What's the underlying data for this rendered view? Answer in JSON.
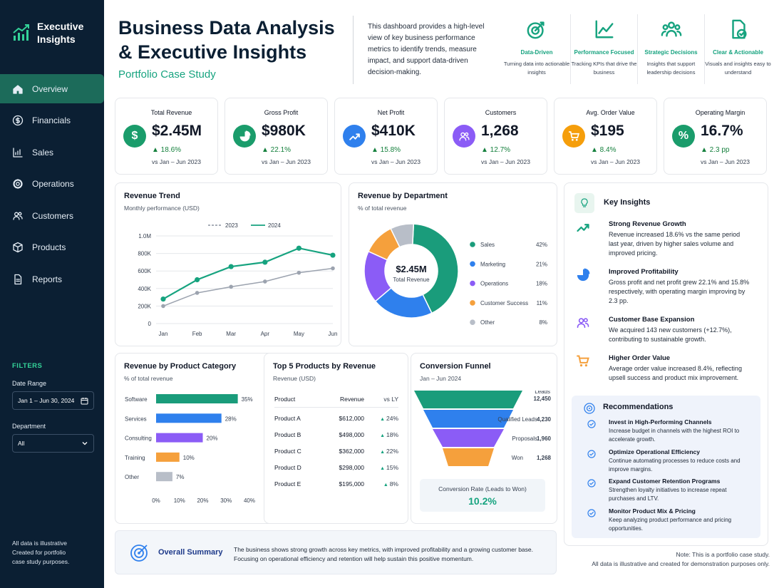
{
  "app": {
    "brand": "Executive Insights"
  },
  "nav": [
    {
      "label": "Overview",
      "icon": "home-icon"
    },
    {
      "label": "Financials",
      "icon": "dollar-icon"
    },
    {
      "label": "Sales",
      "icon": "bar-chart-icon"
    },
    {
      "label": "Operations",
      "icon": "gear-icon"
    },
    {
      "label": "Customers",
      "icon": "users-icon"
    },
    {
      "label": "Products",
      "icon": "box-icon"
    },
    {
      "label": "Reports",
      "icon": "document-icon"
    }
  ],
  "filters": {
    "heading": "FILTERS",
    "date_label": "Date Range",
    "date_value": "Jan 1 – Jun 30, 2024",
    "dept_label": "Department",
    "dept_value": "All"
  },
  "sidebar_footer": [
    "All data is illustrative",
    "Created for portfolio",
    "case study purposes."
  ],
  "header": {
    "title_line1": "Business Data Analysis",
    "title_line2": "& Executive Insights",
    "subtitle": "Portfolio Case Study",
    "intro": "This dashboard provides a high-level view of key business performance metrics to identify trends, measure impact, and support data-driven decision-making."
  },
  "features": [
    {
      "label": "Data-Driven",
      "desc": "Turning data into actionable insights",
      "icon": "target-icon"
    },
    {
      "label": "Performance Focused",
      "desc": "Tracking KPIs that drive the business",
      "icon": "trend-chart-icon"
    },
    {
      "label": "Strategic Decisions",
      "desc": "Insights that support leadership decisions",
      "icon": "team-icon"
    },
    {
      "label": "Clear & Actionable",
      "desc": "Visuals and insights easy to understand",
      "icon": "document-check-icon"
    }
  ],
  "kpis": [
    {
      "title": "Total Revenue",
      "value": "$2.45M",
      "change": "▲ 18.6%",
      "period": "vs Jan – Jun 2023",
      "color": "#1a9c6b",
      "icon": "dollar-icon",
      "glyph": "$"
    },
    {
      "title": "Gross Profit",
      "value": "$980K",
      "change": "▲ 22.1%",
      "period": "vs Jan – Jun 2023",
      "color": "#1a9c6b",
      "icon": "pie-icon",
      "glyph": ""
    },
    {
      "title": "Net Profit",
      "value": "$410K",
      "change": "▲ 15.8%",
      "period": "vs Jan – Jun 2023",
      "color": "#2f80ed",
      "icon": "trend-up-icon",
      "glyph": ""
    },
    {
      "title": "Customers",
      "value": "1,268",
      "change": "▲ 12.7%",
      "period": "vs Jan – Jun 2023",
      "color": "#8b5cf6",
      "icon": "users-icon",
      "glyph": ""
    },
    {
      "title": "Avg. Order Value",
      "value": "$195",
      "change": "▲ 8.4%",
      "period": "vs Jan – Jun 2023",
      "color": "#f59e0b",
      "icon": "cart-icon",
      "glyph": ""
    },
    {
      "title": "Operating Margin",
      "value": "16.7%",
      "change": "▲ 2.3 pp",
      "period": "vs Jan – Jun 2023",
      "color": "#1a9c6b",
      "icon": "percent-icon",
      "glyph": "%"
    }
  ],
  "chart_data": [
    {
      "type": "line",
      "title": "Revenue Trend",
      "subtitle": "Monthly performance (USD)",
      "categories": [
        "Jan",
        "Feb",
        "Mar",
        "Apr",
        "May",
        "Jun"
      ],
      "yticks": [
        "0",
        "200K",
        "400K",
        "600K",
        "800K",
        "1.0M"
      ],
      "ylim": [
        0,
        1000000
      ],
      "series": [
        {
          "name": "2023",
          "color": "#9ca3af",
          "dashed": true,
          "values": [
            200000,
            350000,
            420000,
            480000,
            580000,
            630000
          ]
        },
        {
          "name": "2024",
          "color": "#16a37f",
          "dashed": false,
          "values": [
            280000,
            500000,
            650000,
            700000,
            860000,
            780000
          ]
        }
      ]
    },
    {
      "type": "pie",
      "title": "Revenue by Department",
      "subtitle": "% of total revenue",
      "center_value": "$2.45M",
      "center_label": "Total Revenue",
      "slices": [
        {
          "name": "Sales",
          "value": 42,
          "label": "42%",
          "color": "#1a9c7b"
        },
        {
          "name": "Marketing",
          "value": 21,
          "label": "21%",
          "color": "#2f80ed"
        },
        {
          "name": "Operations",
          "value": 18,
          "label": "18%",
          "color": "#8b5cf6"
        },
        {
          "name": "Customer Success",
          "value": 11,
          "label": "11%",
          "color": "#f5a03c"
        },
        {
          "name": "Other",
          "value": 8,
          "label": "8%",
          "color": "#b8bec8"
        }
      ]
    },
    {
      "type": "bar",
      "title": "Revenue by Product Category",
      "subtitle": "% of total revenue",
      "categories": [
        "Software",
        "Services",
        "Consulting",
        "Training",
        "Other"
      ],
      "values": [
        35,
        28,
        20,
        10,
        7
      ],
      "labels": [
        "35%",
        "28%",
        "20%",
        "10%",
        "7%"
      ],
      "colors": [
        "#1a9c7b",
        "#2f80ed",
        "#8b5cf6",
        "#f5a03c",
        "#b8bec8"
      ],
      "xlim": [
        0,
        40
      ],
      "xticks": [
        "0%",
        "10%",
        "20%",
        "30%",
        "40%"
      ]
    },
    {
      "type": "table",
      "title": "Top 5 Products by Revenue",
      "subtitle": "Revenue (USD)",
      "columns": [
        "Product",
        "Revenue",
        "vs LY"
      ],
      "rows": [
        [
          "Product A",
          "$612,000",
          "24%"
        ],
        [
          "Product B",
          "$498,000",
          "18%"
        ],
        [
          "Product C",
          "$362,000",
          "22%"
        ],
        [
          "Product D",
          "$298,000",
          "15%"
        ],
        [
          "Product E",
          "$195,000",
          "8%"
        ]
      ]
    },
    {
      "type": "funnel",
      "title": "Conversion Funnel",
      "subtitle": "Jan – Jun 2024",
      "stages": [
        {
          "name": "Leads",
          "value": "12,450",
          "color": "#1a9c7b"
        },
        {
          "name": "Qualified Leads",
          "value": "4,230",
          "color": "#2f80ed"
        },
        {
          "name": "Proposals",
          "value": "1,960",
          "color": "#8b5cf6"
        },
        {
          "name": "Won",
          "value": "1,268",
          "color": "#f5a03c"
        }
      ],
      "rate_label": "Conversion Rate (Leads to Won)",
      "rate_value": "10.2%"
    }
  ],
  "insights": {
    "title": "Key Insights",
    "items": [
      {
        "title": "Strong Revenue Growth",
        "body": "Revenue increased 18.6% vs the same period last year, driven by higher sales volume and improved pricing.",
        "icon": "trend-up-icon"
      },
      {
        "title": "Improved Profitability",
        "body": "Gross profit and net profit grew 22.1% and 15.8% respectively, with operating margin improving by 2.3 pp.",
        "icon": "pie-icon"
      },
      {
        "title": "Customer Base Expansion",
        "body": "We acquired 143 new customers (+12.7%), contributing to sustainable growth.",
        "icon": "users-icon"
      },
      {
        "title": "Higher Order Value",
        "body": "Average order value increased 8.4%, reflecting upsell success and product mix improvement.",
        "icon": "cart-icon"
      }
    ]
  },
  "recommendations": {
    "title": "Recommendations",
    "items": [
      {
        "title": "Invest in High-Performing Channels",
        "body": "Increase budget in channels with the highest ROI to accelerate growth."
      },
      {
        "title": "Optimize Operational Efficiency",
        "body": "Continue automating processes to reduce costs and improve margins."
      },
      {
        "title": "Expand Customer Retention Programs",
        "body": "Strengthen loyalty initiatives to increase repeat purchases and LTV."
      },
      {
        "title": "Monitor Product Mix & Pricing",
        "body": "Keep analyzing product performance and pricing opportunities."
      }
    ]
  },
  "summary": {
    "title": "Overall Summary",
    "text": "The business shows strong growth across key metrics, with improved profitability and a growing customer base. Focusing on operational efficiency and retention will help sustain this positive momentum."
  },
  "note": [
    "Note: This is a portfolio case study.",
    "All data is illustrative and created for demonstration purposes only."
  ]
}
